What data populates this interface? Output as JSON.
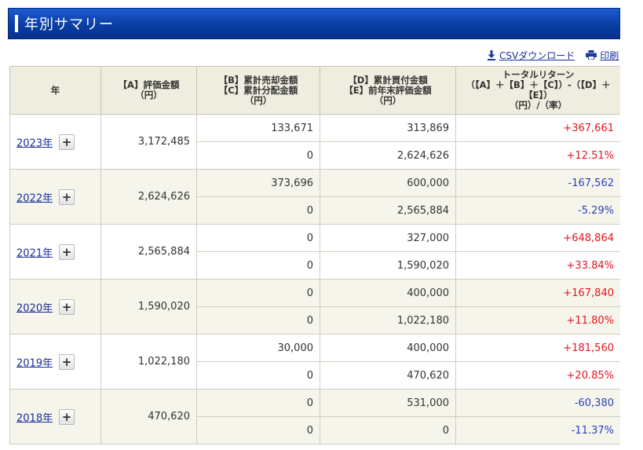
{
  "header": {
    "title": "年別サマリー"
  },
  "actions": {
    "csv_label": "CSVダウンロード",
    "print_label": "印刷"
  },
  "table": {
    "headers": {
      "year": "年",
      "a": [
        "【A】評価金額",
        "（円）"
      ],
      "bc": [
        "【B】累計売却金額",
        "【C】累計分配金額",
        "（円）"
      ],
      "de": [
        "【D】累計買付金額",
        "【E】前年末評価金額",
        "（円）"
      ],
      "tr": [
        "トータルリターン",
        "（【A】＋【B】＋【C】）-（【D】＋【E】）",
        "（円）/（率）"
      ]
    },
    "rows": [
      {
        "year": "2023年",
        "a": "3,172,485",
        "b": "133,671",
        "c": "0",
        "d": "313,869",
        "e": "2,624,626",
        "return_yen": "+367,661",
        "return_pct": "+12.51%",
        "sign": "pos"
      },
      {
        "year": "2022年",
        "a": "2,624,626",
        "b": "373,696",
        "c": "0",
        "d": "600,000",
        "e": "2,565,884",
        "return_yen": "-167,562",
        "return_pct": "-5.29%",
        "sign": "neg"
      },
      {
        "year": "2021年",
        "a": "2,565,884",
        "b": "0",
        "c": "0",
        "d": "327,000",
        "e": "1,590,020",
        "return_yen": "+648,864",
        "return_pct": "+33.84%",
        "sign": "pos"
      },
      {
        "year": "2020年",
        "a": "1,590,020",
        "b": "0",
        "c": "0",
        "d": "400,000",
        "e": "1,022,180",
        "return_yen": "+167,840",
        "return_pct": "+11.80%",
        "sign": "pos"
      },
      {
        "year": "2019年",
        "a": "1,022,180",
        "b": "30,000",
        "c": "0",
        "d": "400,000",
        "e": "470,620",
        "return_yen": "+181,560",
        "return_pct": "+20.85%",
        "sign": "pos"
      },
      {
        "year": "2018年",
        "a": "470,620",
        "b": "0",
        "c": "0",
        "d": "531,000",
        "e": "0",
        "return_yen": "-60,380",
        "return_pct": "-11.37%",
        "sign": "neg"
      }
    ],
    "expand_label": "+"
  },
  "colors": {
    "title_bar": "#0a3fa3",
    "positive": "#e3141f",
    "negative": "#2b3fb8",
    "header_bg": "#efeddf"
  }
}
